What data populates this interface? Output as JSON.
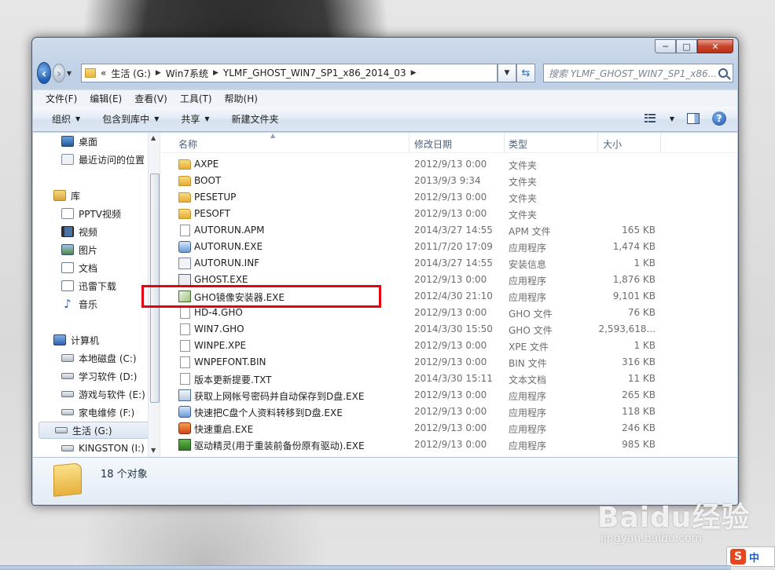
{
  "window": {
    "controls": {
      "minimize": "─",
      "maximize": "□",
      "close": "✕"
    }
  },
  "address": {
    "chevron": "«",
    "crumbs": [
      "生活 (G:)",
      "Win7系统",
      "YLMF_GHOST_WIN7_SP1_x86_2014_03"
    ],
    "search_placeholder": "搜索 YLMF_GHOST_WIN7_SP1_x86..."
  },
  "menu": [
    "文件(F)",
    "编辑(E)",
    "查看(V)",
    "工具(T)",
    "帮助(H)"
  ],
  "commands": {
    "organize": "组织",
    "include_library": "包含到库中",
    "share": "共享",
    "new_folder": "新建文件夹"
  },
  "nav": {
    "desktop": "桌面",
    "recent": "最近访问的位置",
    "library": "库",
    "pptv": "PPTV视频",
    "video": "视频",
    "pictures": "图片",
    "documents": "文档",
    "thunder": "迅雷下载",
    "music": "音乐",
    "computer": "计算机",
    "drives": [
      "本地磁盘 (C:)",
      "学习软件 (D:)",
      "游戏与软件 (E:)",
      "家电维修 (F:)",
      "生活 (G:)",
      "KINGSTON (I:)"
    ]
  },
  "columns": {
    "name": "名称",
    "date": "修改日期",
    "type": "类型",
    "size": "大小"
  },
  "files": [
    {
      "name": "AXPE",
      "date": "2012/9/13 0:00",
      "type": "文件夹",
      "size": "",
      "icon": "folder-icon"
    },
    {
      "name": "BOOT",
      "date": "2013/9/3 9:34",
      "type": "文件夹",
      "size": "",
      "icon": "folder-icon"
    },
    {
      "name": "PESETUP",
      "date": "2012/9/13 0:00",
      "type": "文件夹",
      "size": "",
      "icon": "folder-icon"
    },
    {
      "name": "PESOFT",
      "date": "2012/9/13 0:00",
      "type": "文件夹",
      "size": "",
      "icon": "folder-icon"
    },
    {
      "name": "AUTORUN.APM",
      "date": "2014/3/27 14:55",
      "type": "APM 文件",
      "size": "165 KB",
      "icon": "file-icon"
    },
    {
      "name": "AUTORUN.EXE",
      "date": "2011/7/20 17:09",
      "type": "应用程序",
      "size": "1,474 KB",
      "icon": "exe-icon"
    },
    {
      "name": "AUTORUN.INF",
      "date": "2014/3/27 14:55",
      "type": "安装信息",
      "size": "1 KB",
      "icon": "inf-icon"
    },
    {
      "name": "GHOST.EXE",
      "date": "2012/9/13 0:00",
      "type": "应用程序",
      "size": "1,876 KB",
      "icon": "ghost-icon"
    },
    {
      "name": "GHO镜像安装器.EXE",
      "date": "2012/4/30 21:10",
      "type": "应用程序",
      "size": "9,101 KB",
      "icon": "installer-icon"
    },
    {
      "name": "HD-4.GHO",
      "date": "2012/9/13 0:00",
      "type": "GHO 文件",
      "size": "76 KB",
      "icon": "file-icon"
    },
    {
      "name": "WIN7.GHO",
      "date": "2014/3/30 15:50",
      "type": "GHO 文件",
      "size": "2,593,618...",
      "icon": "file-icon"
    },
    {
      "name": "WINPE.XPE",
      "date": "2012/9/13 0:00",
      "type": "XPE 文件",
      "size": "1 KB",
      "icon": "file-icon"
    },
    {
      "name": "WNPEFONT.BIN",
      "date": "2012/9/13 0:00",
      "type": "BIN 文件",
      "size": "316 KB",
      "icon": "file-icon"
    },
    {
      "name": "版本更新提要.TXT",
      "date": "2014/3/30 15:11",
      "type": "文本文档",
      "size": "11 KB",
      "icon": "text-file-icon"
    },
    {
      "name": "获取上网帐号密码并自动保存到D盘.EXE",
      "date": "2012/9/13 0:00",
      "type": "应用程序",
      "size": "265 KB",
      "icon": "user-exe-icon"
    },
    {
      "name": "快速把C盘个人资料转移到D盘.EXE",
      "date": "2012/9/13 0:00",
      "type": "应用程序",
      "size": "118 KB",
      "icon": "exe-icon"
    },
    {
      "name": "快速重启.EXE",
      "date": "2012/9/13 0:00",
      "type": "应用程序",
      "size": "246 KB",
      "icon": "restart-icon"
    },
    {
      "name": "驱动精灵(用于重装前备份原有驱动).EXE",
      "date": "2012/9/13 0:00",
      "type": "应用程序",
      "size": "985 KB",
      "icon": "driver-icon"
    }
  ],
  "status": {
    "count": "18 个对象"
  },
  "overlay": {
    "watermark": "Baidu经验",
    "watermark_sub": "jingyan.baidu.com",
    "ime_logo": "S",
    "ime_label": "中"
  },
  "colors": {
    "highlight": "#e60012",
    "window_frame": "#c6d6ea"
  }
}
